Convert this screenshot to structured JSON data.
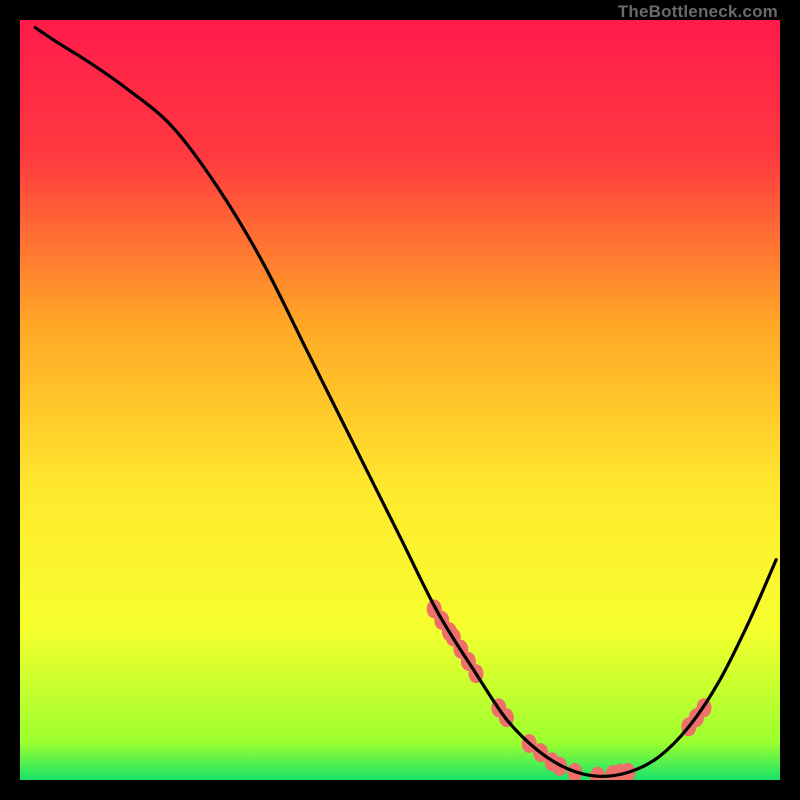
{
  "watermark": "TheBottleneck.com",
  "chart_data": {
    "type": "line",
    "title": "",
    "xlabel": "",
    "ylabel": "",
    "xlim": [
      0,
      100
    ],
    "ylim": [
      0,
      100
    ],
    "gradient_stops": [
      {
        "offset": 0.0,
        "color": "#ff1b4b"
      },
      {
        "offset": 0.18,
        "color": "#ff3a3f"
      },
      {
        "offset": 0.4,
        "color": "#ffa726"
      },
      {
        "offset": 0.62,
        "color": "#ffe92e"
      },
      {
        "offset": 0.8,
        "color": "#f6ff2e"
      },
      {
        "offset": 0.95,
        "color": "#9dff2e"
      },
      {
        "offset": 1.0,
        "color": "#19e36a"
      }
    ],
    "series": [
      {
        "name": "bottleneck-curve",
        "type": "line",
        "color": "#000000",
        "x": [
          2,
          5,
          9,
          14,
          20,
          26,
          32,
          38,
          44,
          50,
          55,
          60,
          64,
          68,
          72,
          76,
          80,
          84,
          88,
          92,
          96,
          99.5
        ],
        "y": [
          99,
          97,
          94.5,
          91,
          86,
          78,
          68,
          56,
          44,
          32,
          22,
          14,
          8,
          4,
          1.5,
          0.5,
          1,
          3,
          7,
          13,
          21,
          29
        ]
      },
      {
        "name": "gpu-markers",
        "type": "scatter",
        "color": "#ef6f6b",
        "x": [
          54.5,
          55.5,
          56.5,
          57.0,
          58.0,
          59.0,
          60.0,
          63.0,
          64.0,
          67.0,
          68.5,
          70.0,
          71.0,
          73.0,
          76.0,
          78.0,
          79.0,
          80.0,
          88.0,
          89.0,
          90.0
        ],
        "y": [
          22.5,
          21.0,
          19.5,
          18.8,
          17.2,
          15.6,
          14.0,
          9.5,
          8.2,
          4.8,
          3.6,
          2.4,
          1.8,
          1.0,
          0.5,
          0.7,
          0.9,
          1.0,
          7.0,
          8.2,
          9.5
        ]
      }
    ]
  }
}
